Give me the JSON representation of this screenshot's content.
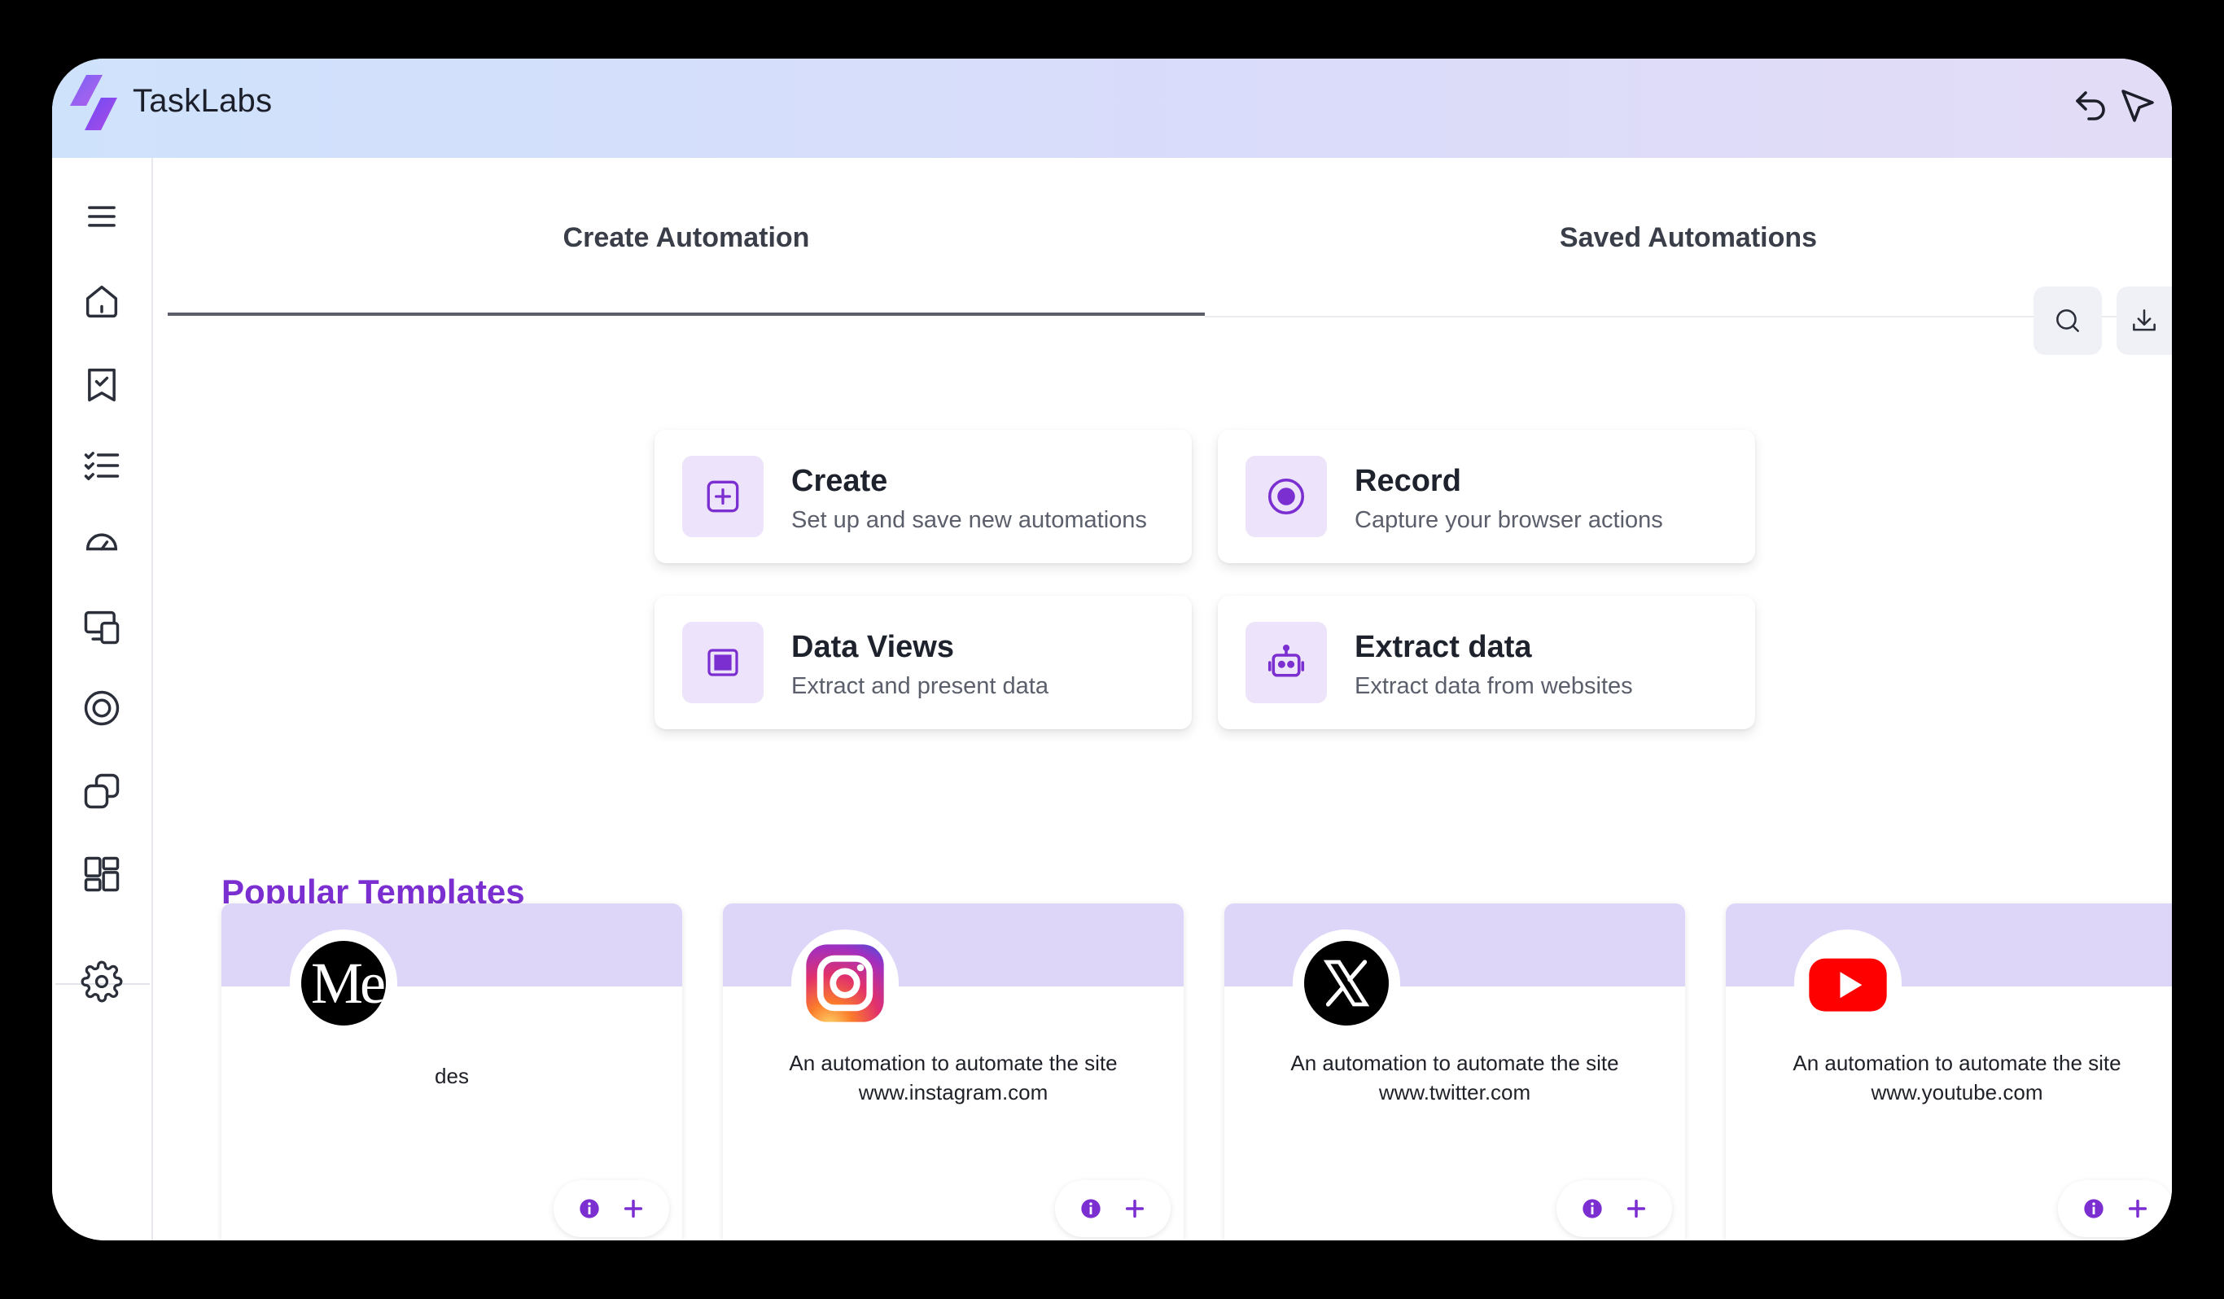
{
  "app": {
    "title": "TaskLabs"
  },
  "tabs": [
    {
      "label": "Create Automation",
      "active": true
    },
    {
      "label": "Saved Automations",
      "active": false
    }
  ],
  "toolbar": {
    "icons": [
      "search-icon",
      "download-icon"
    ]
  },
  "topbar_icons": [
    "undo-icon",
    "cursor-icon"
  ],
  "sidebar": {
    "icons": [
      "menu-icon",
      "home-icon",
      "bookmark-check-icon",
      "checklist-icon",
      "gauge-icon",
      "devices-icon",
      "target-icon",
      "copy-icon",
      "dashboard-icon",
      "settings-icon"
    ]
  },
  "actions": [
    {
      "title": "Create",
      "subtitle": "Set up and save new automations",
      "icon": "plus-square-icon"
    },
    {
      "title": "Record",
      "subtitle": "Capture your browser actions",
      "icon": "record-icon"
    },
    {
      "title": "Data Views",
      "subtitle": "Extract and present data",
      "icon": "grid-table-icon"
    },
    {
      "title": "Extract data",
      "subtitle": "Extract data from websites",
      "icon": "robot-icon"
    }
  ],
  "templates": {
    "title": "Popular Templates",
    "items": [
      {
        "logo_text": "Me",
        "logo": "medium-logo",
        "desc": "des"
      },
      {
        "logo": "instagram-logo",
        "desc": "An automation to automate the site www.instagram.com"
      },
      {
        "logo": "x-logo",
        "desc": "An automation to automate the site www.twitter.com"
      },
      {
        "logo": "youtube-logo",
        "desc": "An automation to automate the site www.youtube.com"
      }
    ]
  },
  "colors": {
    "accent": "#7b2fd0",
    "icon_bg": "#ede4fb",
    "band": "#ded6f9"
  }
}
